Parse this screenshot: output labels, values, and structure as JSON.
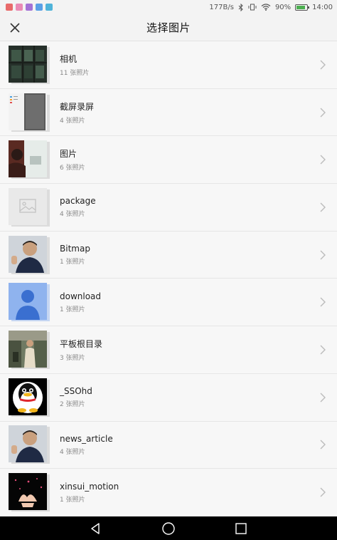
{
  "status_bar": {
    "net_speed": "177B/s",
    "battery_percent": "90%",
    "time": "14:00",
    "battery_level": 0.9
  },
  "header": {
    "title": "选择图片",
    "close_icon": "close-icon"
  },
  "albums": [
    {
      "name": "相机",
      "count": "11 张照片"
    },
    {
      "name": "截屏录屏",
      "count": "4 张照片"
    },
    {
      "name": "图片",
      "count": "6 张照片"
    },
    {
      "name": "package",
      "count": "4 张照片"
    },
    {
      "name": "Bitmap",
      "count": "1 张照片"
    },
    {
      "name": "download",
      "count": "1 张照片"
    },
    {
      "name": "平板根目录",
      "count": "3 张照片"
    },
    {
      "name": "_SSOhd",
      "count": "2 张照片"
    },
    {
      "name": "news_article",
      "count": "4 张照片"
    },
    {
      "name": "xinsui_motion",
      "count": "1 张照片"
    }
  ],
  "nav_bar": {
    "back_icon": "back-triangle-icon",
    "home_icon": "home-circle-icon",
    "recents_icon": "recents-square-icon"
  },
  "colors": {
    "accent_battery": "#4caf50",
    "background": "#f7f7f7",
    "nav_bar": "#000000"
  }
}
